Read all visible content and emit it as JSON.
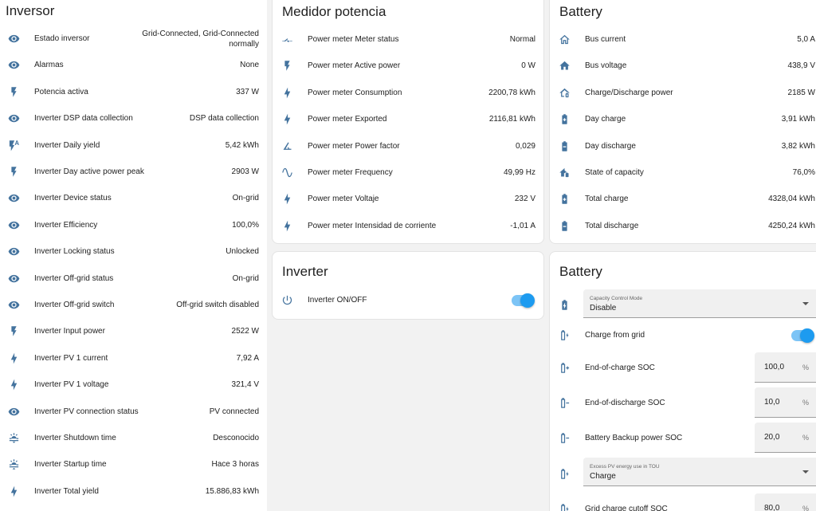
{
  "colors": {
    "icon": "#44739e",
    "toggle_on": "#1d9bf0",
    "card_bg": "#ffffff",
    "page_bg": "#f2f2f2"
  },
  "inversor": {
    "title": "Inversor",
    "rows": [
      {
        "icon": "eye-icon",
        "label": "Estado inversor",
        "value": "Grid-Connected, Grid-Connected normally"
      },
      {
        "icon": "eye-icon",
        "label": "Alarmas",
        "value": "None"
      },
      {
        "icon": "flash-icon",
        "label": "Potencia activa",
        "value": "337 W"
      },
      {
        "icon": "eye-icon",
        "label": "Inverter DSP data collection",
        "value": "DSP data collection"
      },
      {
        "icon": "flash-auto-icon",
        "label": "Inverter Daily yield",
        "value": "5,42 kWh"
      },
      {
        "icon": "flash-icon",
        "label": "Inverter Day active power peak",
        "value": "2903 W"
      },
      {
        "icon": "eye-icon",
        "label": "Inverter Device status",
        "value": "On-grid"
      },
      {
        "icon": "eye-icon",
        "label": "Inverter Efficiency",
        "value": "100,0%"
      },
      {
        "icon": "eye-icon",
        "label": "Inverter Locking status",
        "value": "Unlocked"
      },
      {
        "icon": "eye-icon",
        "label": "Inverter Off-grid status",
        "value": "On-grid"
      },
      {
        "icon": "eye-icon",
        "label": "Inverter Off-grid switch",
        "value": "Off-grid switch disabled"
      },
      {
        "icon": "flash-icon",
        "label": "Inverter Input power",
        "value": "2522 W"
      },
      {
        "icon": "lightning-bolt-icon",
        "label": "Inverter PV 1 current",
        "value": "7,92 A"
      },
      {
        "icon": "lightning-bolt-icon",
        "label": "Inverter PV 1 voltage",
        "value": "321,4 V"
      },
      {
        "icon": "eye-icon",
        "label": "Inverter PV connection status",
        "value": "PV connected"
      },
      {
        "icon": "weather-sunset-icon",
        "label": "Inverter Shutdown time",
        "value": "Desconocido"
      },
      {
        "icon": "weather-sunrise-icon",
        "label": "Inverter Startup time",
        "value": "Hace 3 horas"
      },
      {
        "icon": "lightning-bolt-icon",
        "label": "Inverter Total yield",
        "value": "15.886,83 kWh"
      }
    ]
  },
  "medidor": {
    "title": "Medidor potencia",
    "rows": [
      {
        "icon": "switch-icon",
        "label": "Power meter Meter status",
        "value": "Normal"
      },
      {
        "icon": "flash-icon",
        "label": "Power meter Active power",
        "value": "0 W"
      },
      {
        "icon": "lightning-bolt-icon",
        "label": "Power meter Consumption",
        "value": "2200,78 kWh"
      },
      {
        "icon": "lightning-bolt-icon",
        "label": "Power meter Exported",
        "value": "2116,81 kWh"
      },
      {
        "icon": "angle-icon",
        "label": "Power meter Power factor",
        "value": "0,029"
      },
      {
        "icon": "sine-wave-icon",
        "label": "Power meter Frequency",
        "value": "49,99 Hz"
      },
      {
        "icon": "lightning-bolt-icon",
        "label": "Power meter Voltaje",
        "value": "232 V"
      },
      {
        "icon": "lightning-bolt-icon",
        "label": "Power meter Intensidad de corriente",
        "value": "-1,01 A"
      }
    ]
  },
  "inverter": {
    "title": "Inverter",
    "switch_label": "Inverter ON/OFF",
    "switch_on": true
  },
  "battery1": {
    "title": "Battery",
    "rows": [
      {
        "icon": "home-outline-icon",
        "label": "Bus current",
        "value": "5,0 A"
      },
      {
        "icon": "home-icon",
        "label": "Bus voltage",
        "value": "438,9 V"
      },
      {
        "icon": "home-battery-outline-icon",
        "label": "Charge/Discharge power",
        "value": "2185 W"
      },
      {
        "icon": "battery-plus-icon",
        "label": "Day charge",
        "value": "3,91 kWh"
      },
      {
        "icon": "battery-minus-icon",
        "label": "Day discharge",
        "value": "3,82 kWh"
      },
      {
        "icon": "home-battery-icon",
        "label": "State of capacity",
        "value": "76,0%"
      },
      {
        "icon": "battery-plus-icon",
        "label": "Total charge",
        "value": "4328,04 kWh"
      },
      {
        "icon": "battery-minus-icon",
        "label": "Total discharge",
        "value": "4250,24 kWh"
      }
    ]
  },
  "battery2": {
    "title": "Battery",
    "capacity_mode": {
      "label": "Capacity Control Mode",
      "value": "Disable"
    },
    "charge_from_grid": {
      "label": "Charge from grid",
      "on": true
    },
    "end_of_charge": {
      "label": "End-of-charge SOC",
      "value": "100,0",
      "unit": "%"
    },
    "end_of_discharge": {
      "label": "End-of-discharge SOC",
      "value": "10,0",
      "unit": "%"
    },
    "backup_soc": {
      "label": "Battery Backup power SOC",
      "value": "20,0",
      "unit": "%"
    },
    "excess_pv": {
      "label": "Excess PV energy use in TOU",
      "value": "Charge"
    },
    "grid_cutoff": {
      "label": "Grid charge cutoff SOC",
      "value": "80,0",
      "unit": "%"
    }
  }
}
